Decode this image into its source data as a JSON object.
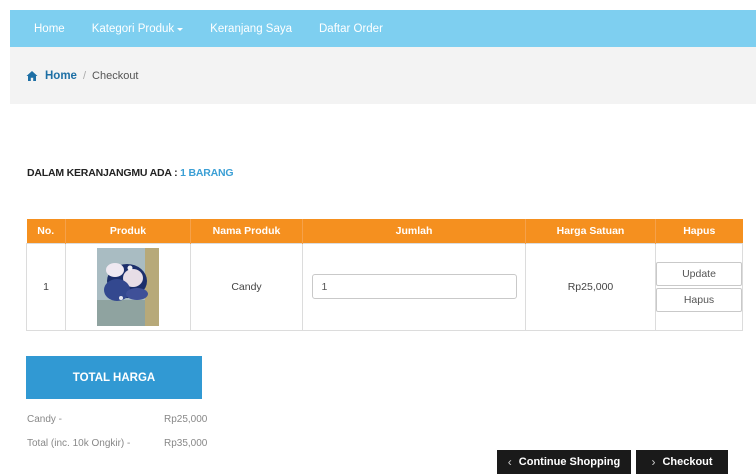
{
  "nav": {
    "items": [
      {
        "label": "Home"
      },
      {
        "label": "Kategori Produk"
      },
      {
        "label": "Keranjang Saya"
      },
      {
        "label": "Daftar Order"
      }
    ]
  },
  "breadcrumb": {
    "home": "Home",
    "separator": "/",
    "current": "Checkout"
  },
  "cart_summary": {
    "label": "DALAM KERANJANGMU ADA :",
    "count": "1 BARANG"
  },
  "table": {
    "headers": [
      "No.",
      "Produk",
      "Nama Produk",
      "Jumlah",
      "Harga Satuan",
      "Hapus"
    ],
    "rows": [
      {
        "no": "1",
        "name": "Candy",
        "qty": "1",
        "price": "Rp25,000",
        "update_label": "Update",
        "delete_label": "Hapus"
      }
    ]
  },
  "total": {
    "title": "TOTAL HARGA",
    "lines": [
      {
        "label": "Candy -",
        "value": "Rp25,000"
      },
      {
        "label": "Total (inc. 10k Ongkir) -",
        "value": "Rp35,000"
      }
    ]
  },
  "actions": {
    "continue": "Continue Shopping",
    "checkout": "Checkout"
  },
  "colors": {
    "navbar": "#7ecff0",
    "table_header": "#f5901f",
    "total_box": "#3199d3",
    "link": "#1d6fa5",
    "count": "#3b9fd5",
    "dark_button": "#1a1a1a"
  }
}
